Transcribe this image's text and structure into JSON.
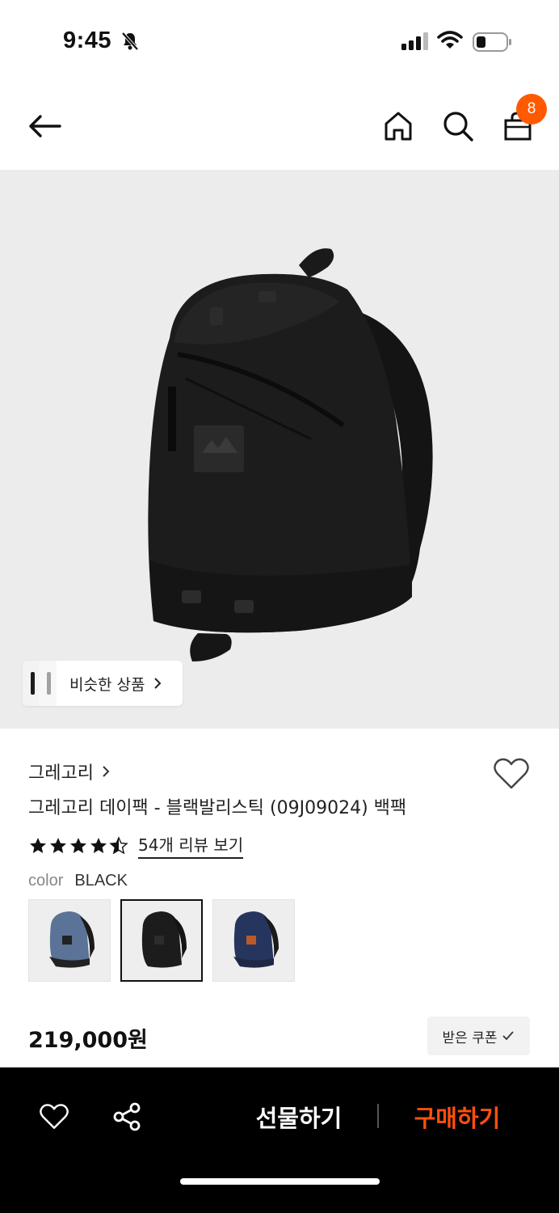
{
  "status_bar": {
    "time": "9:45",
    "icons": [
      "bell-slash-icon",
      "signal-icon",
      "wifi-icon",
      "battery-icon"
    ]
  },
  "nav": {
    "icons": [
      "arrow-left-icon",
      "home-icon",
      "search-icon",
      "shopping-bag-icon"
    ],
    "cart_count": "8",
    "badge_color": "#ff5a00"
  },
  "hero": {
    "background": "#ececec",
    "similar_label": "비슷한 상품"
  },
  "product": {
    "brand": "그레고리",
    "title": "그레고리 데이팩 - 블랙발리스틱 (09J09024) 백팩",
    "rating": 4.5,
    "review_link": "54개 리뷰 보기",
    "color_key": "color",
    "color_value": "BLACK",
    "swatches": [
      {
        "name": "blue",
        "color": "#5b7396",
        "selected": false
      },
      {
        "name": "black",
        "color": "#1c1c1c",
        "selected": true
      },
      {
        "name": "navy",
        "color": "#26355d",
        "selected": false
      }
    ],
    "price": "219,000원",
    "coupon_label": "받은 쿠폰"
  },
  "bottom_bar": {
    "gift_label": "선물하기",
    "buy_label": "구매하기",
    "buy_color": "#ff4f0f"
  }
}
